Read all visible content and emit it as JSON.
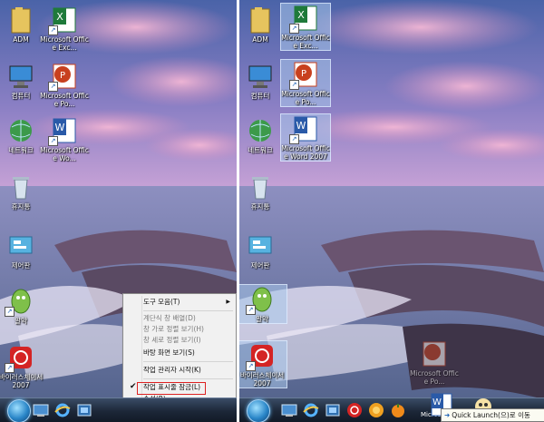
{
  "left": {
    "icons": [
      {
        "label": "ADM",
        "type": "folder"
      },
      {
        "label": "Microsoft Office Exc...",
        "type": "excel"
      },
      {
        "label": "컴퓨터",
        "type": "computer"
      },
      {
        "label": "Microsoft Office Po...",
        "type": "powerpoint"
      },
      {
        "label": "네트워크",
        "type": "network"
      },
      {
        "label": "Microsoft Office Wo...",
        "type": "word"
      },
      {
        "label": "휴지통",
        "type": "recycle"
      },
      {
        "label": "제어판",
        "type": "control"
      },
      {
        "label": "알약",
        "type": "alyac"
      },
      {
        "label": "바이러스체이서 2007",
        "type": "virus"
      }
    ],
    "context_menu": {
      "items": [
        {
          "label": "도구 모음(T)",
          "disabled": false,
          "submenu": true
        },
        {
          "label": "계단식 창 배열(D)",
          "disabled": true
        },
        {
          "label": "창 가로 정렬 보기(H)",
          "disabled": true
        },
        {
          "label": "창 세로 정렬 보기(I)",
          "disabled": true
        },
        {
          "label": "바탕 화면 보기(S)",
          "disabled": false
        },
        {
          "label": "작업 관리자 시작(K)",
          "disabled": false
        },
        {
          "label": "작업 표시줄 잠금(L)",
          "disabled": false,
          "checked": true
        },
        {
          "label": "속성(R)",
          "disabled": false
        }
      ]
    }
  },
  "right": {
    "icons": [
      {
        "label": "ADM",
        "type": "folder"
      },
      {
        "label": "Microsoft Office Exc...",
        "type": "excel"
      },
      {
        "label": "컴퓨터",
        "type": "computer"
      },
      {
        "label": "Microsoft Office Po...",
        "type": "powerpoint"
      },
      {
        "label": "네트워크",
        "type": "network"
      },
      {
        "label": "Microsoft Office Word 2007",
        "type": "word"
      },
      {
        "label": "휴지통",
        "type": "recycle"
      },
      {
        "label": "제어판",
        "type": "control"
      },
      {
        "label": "알약",
        "type": "alyac"
      },
      {
        "label": "바이러스체이서 2007",
        "type": "virus"
      }
    ],
    "dragging_label": "Microsoft Office Po...",
    "taskbar_drag_label": "Micros",
    "tooltip": "Quick Launch(으)로 이동"
  },
  "colors": {
    "excel": "#1f7a3a",
    "powerpoint": "#c8401e",
    "word": "#2a5aa8",
    "folder": "#e8c15a",
    "taskbar": "#1c2738",
    "accent": "#d22222"
  }
}
